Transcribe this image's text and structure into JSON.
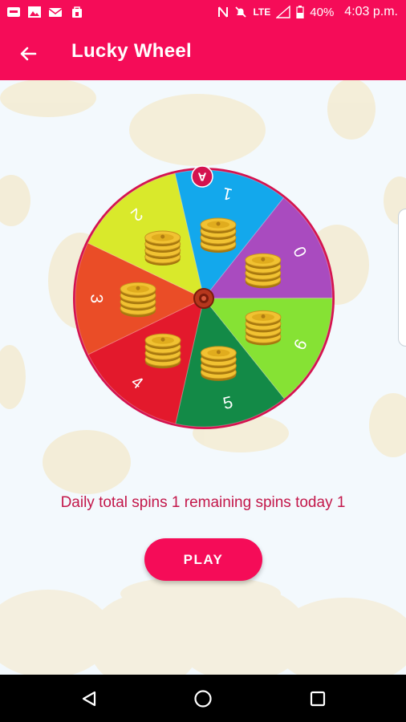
{
  "status_bar": {
    "left_icons": [
      "nfc-app-icon",
      "image-icon",
      "mail-icon",
      "shopping-bag-icon"
    ],
    "network": "LTE",
    "battery": "40%",
    "time": "4:03 p.m."
  },
  "app_bar": {
    "back_icon": "arrow-left-icon",
    "title": "Lucky Wheel"
  },
  "wheel": {
    "pointer_label": "A",
    "segments": [
      {
        "label": "1",
        "color": "#13a8ec"
      },
      {
        "label": "0",
        "color": "#a94bbf"
      },
      {
        "label": "6",
        "color": "#86e234"
      },
      {
        "label": "5",
        "color": "#138a47"
      },
      {
        "label": "4",
        "color": "#e3192c"
      },
      {
        "label": "3",
        "color": "#ea4d27"
      },
      {
        "label": "2",
        "color": "#d9e92b"
      }
    ],
    "rim_color": "#d4134f"
  },
  "spins_text": "Daily total spins 1 remaining spins today 1",
  "play_label": "PLAY",
  "nav_bar": {
    "back_icon": "triangle-back-icon",
    "home_icon": "circle-home-icon",
    "recents_icon": "square-recents-icon"
  },
  "colors": {
    "primary": "#f50c58",
    "text_accent": "#c3174a"
  }
}
